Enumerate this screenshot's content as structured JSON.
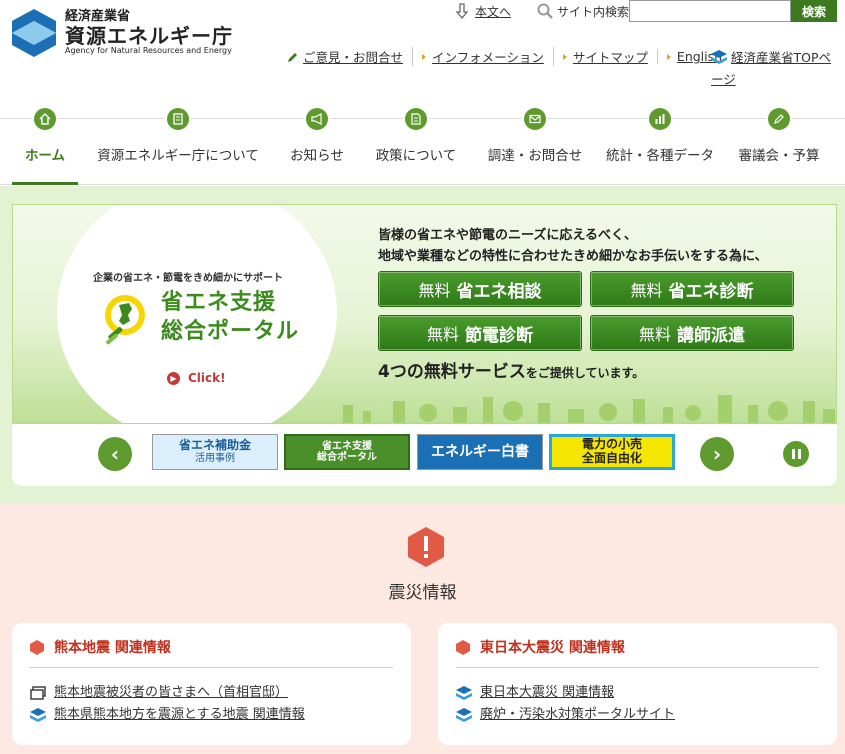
{
  "header": {
    "logo": {
      "line1": "経済産業省",
      "line2": "資源エネルギー庁",
      "line3": "Agency for Natural Resources and Energy"
    },
    "skip_link": "本文へ",
    "search": {
      "label": "サイト内検索",
      "value": "",
      "button": "検索"
    },
    "util_links": [
      {
        "label": "ご意見・お問合せ"
      },
      {
        "label": "インフォメーション"
      },
      {
        "label": "サイトマップ"
      },
      {
        "label": "English"
      }
    ],
    "meti_top": "経済産業省TOPページ"
  },
  "gnav": [
    {
      "label": "ホーム",
      "icon": "home-icon",
      "active": true
    },
    {
      "label": "資源エネルギー庁について",
      "icon": "building-icon"
    },
    {
      "label": "お知らせ",
      "icon": "megaphone-icon"
    },
    {
      "label": "政策について",
      "icon": "document-icon"
    },
    {
      "label": "調達・お問合せ",
      "icon": "envelope-icon"
    },
    {
      "label": "統計・各種データ",
      "icon": "bar-chart-icon"
    },
    {
      "label": "審議会・予算",
      "icon": "pencil-icon"
    }
  ],
  "banner": {
    "lead": "企業の省エネ・節電をきめ細かにサポート",
    "title_line1": "省エネ支援",
    "title_line2": "総合ポータル",
    "click": "Click!",
    "text_line1": "皆様の省エネや節電のニーズに応えるべく、",
    "text_line2": "地域や業種などの特性に合わせたきめ細かなお手伝いをする為に、",
    "services": [
      {
        "prefix": "無料",
        "name": "省エネ相談"
      },
      {
        "prefix": "無料",
        "name": "省エネ診断"
      },
      {
        "prefix": "無料",
        "name": "節電診断"
      },
      {
        "prefix": "無料",
        "name": "講師派遣"
      }
    ],
    "sub_main": "4つの無料サービス",
    "sub_small": "をご提供しています。"
  },
  "carousel": {
    "items": [
      {
        "line1": "省エネ補助金",
        "line2": "活用事例"
      },
      {
        "line1": "省エネ支援",
        "line2": "総合ポータル"
      },
      {
        "line1": "エネルギー白書",
        "line2": ""
      },
      {
        "line1": "電力の小売",
        "line2": "全面自由化"
      }
    ],
    "prev": "‹",
    "next": "›"
  },
  "disaster": {
    "title": "震災情報",
    "cards": [
      {
        "heading": "熊本地震 関連情報",
        "links": [
          {
            "label": "熊本地震被災者の皆さまへ（首相官邸）",
            "icon": "window-icon"
          },
          {
            "label": "熊本県熊本地方を震源とする地震 関連情報",
            "icon": "meti-logo-icon"
          }
        ]
      },
      {
        "heading": "東日本大震災 関連情報",
        "links": [
          {
            "label": "東日本大震災 関連情報",
            "icon": "meti-logo-icon"
          },
          {
            "label": "廃炉・汚染水対策ポータルサイト",
            "icon": "meti-logo-icon"
          }
        ]
      }
    ]
  },
  "colors": {
    "brand_green": "#3d7a1f",
    "nav_green": "#5f9a2e",
    "logo_blue": "#1b6fb5",
    "alert_red": "#e05a45",
    "hero_bg": "#e3f2d3",
    "disaster_bg": "#fde8e2"
  }
}
